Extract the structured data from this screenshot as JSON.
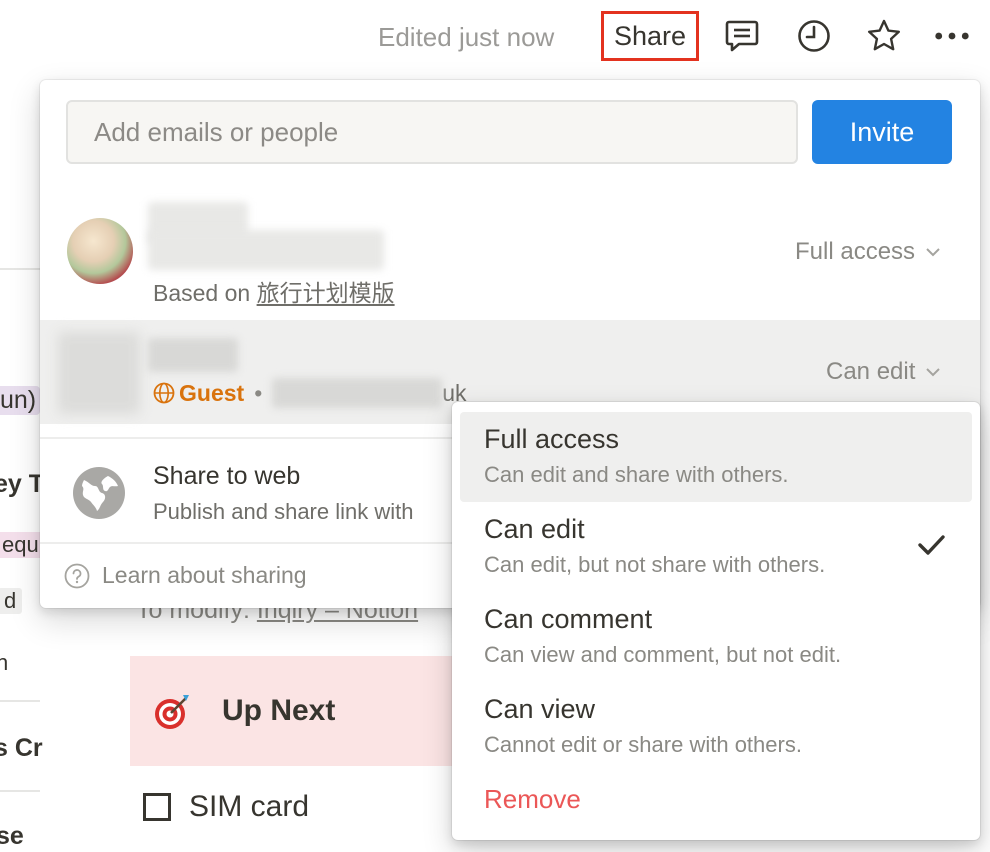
{
  "topbar": {
    "edited_status": "Edited just now",
    "share_label": "Share",
    "icons": [
      "comment-icon",
      "clock-icon",
      "star-icon",
      "more-icon"
    ]
  },
  "page_background": {
    "fragments": [
      "un)",
      "ey T",
      "equi",
      "d",
      "n",
      "s Cr",
      "se",
      "To modify: ",
      "Inqiry – Notion"
    ],
    "callout_title": "Up Next",
    "todo_item": "SIM card"
  },
  "share_panel": {
    "email_placeholder": "Add emails or people",
    "invite_label": "Invite",
    "members": [
      {
        "based_on_prefix": "Based on ",
        "based_on_link": "旅行计划模版",
        "access": "Full access"
      },
      {
        "guest_label": "Guest",
        "separator": "•",
        "email_suffix": "uk",
        "access": "Can edit"
      }
    ],
    "share_to_web": {
      "title": "Share to web",
      "subtitle": "Publish and share link with"
    },
    "learn_label": "Learn about sharing"
  },
  "permission_menu": {
    "items": [
      {
        "title": "Full access",
        "description": "Can edit and share with others."
      },
      {
        "title": "Can edit",
        "description": "Can edit, but not share with others."
      },
      {
        "title": "Can comment",
        "description": "Can view and comment, but not edit."
      },
      {
        "title": "Can view",
        "description": "Cannot edit or share with others."
      }
    ],
    "highlighted_index": 0,
    "selected_index": 1,
    "remove_label": "Remove"
  },
  "colors": {
    "accent": "#2383e2",
    "share_highlight_border": "#e3321f",
    "guest": "#d9730d",
    "remove": "#eb5757",
    "callout_bg": "#fbe4e4"
  }
}
